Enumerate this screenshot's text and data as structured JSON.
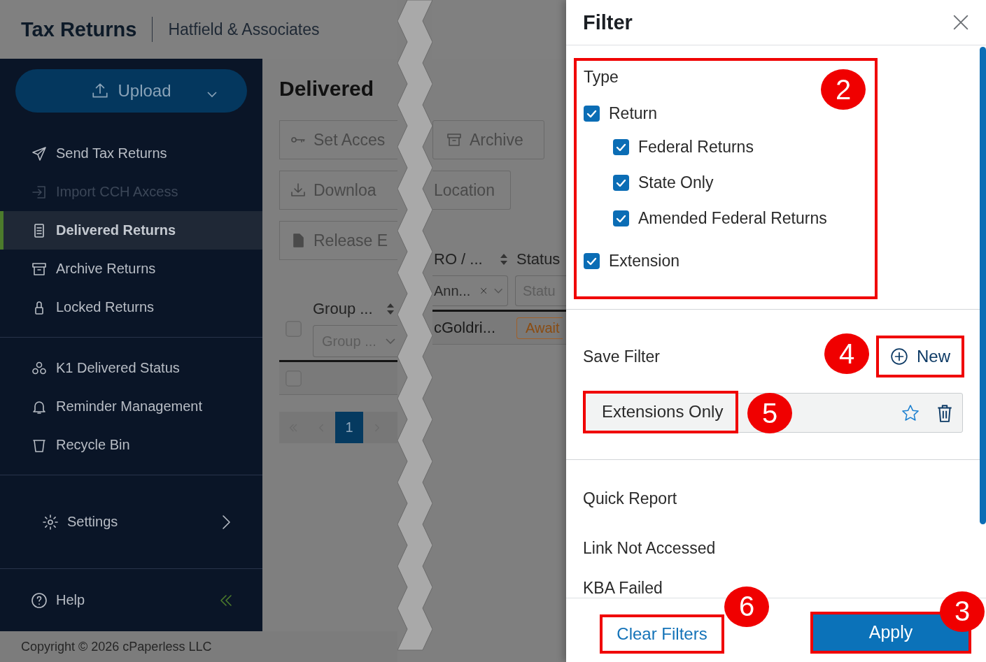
{
  "header": {
    "title": "Tax Returns",
    "firm": "Hatfield & Associates"
  },
  "sidebar": {
    "upload": "Upload",
    "groups": [
      {
        "items": [
          {
            "label": "Send Tax Returns",
            "selected": false,
            "disabled": false
          },
          {
            "label": "Import CCH Axcess",
            "selected": false,
            "disabled": true
          },
          {
            "label": "Delivered Returns",
            "selected": true,
            "disabled": false
          },
          {
            "label": "Archive Returns",
            "selected": false,
            "disabled": false
          },
          {
            "label": "Locked Returns",
            "selected": false,
            "disabled": false
          }
        ]
      },
      {
        "items": [
          {
            "label": "K1 Delivered Status",
            "selected": false,
            "disabled": false
          },
          {
            "label": "Reminder Management",
            "selected": false,
            "disabled": false
          },
          {
            "label": "Recycle Bin",
            "selected": false,
            "disabled": false
          }
        ]
      }
    ],
    "settings": "Settings",
    "help": "Help"
  },
  "content": {
    "title": "Delivered",
    "actions_left": [
      "Set Acces",
      "Downloa",
      "Release E"
    ],
    "actions_right": [
      "Archive",
      "Location"
    ],
    "table": {
      "header_checked": false,
      "columns_left": [
        {
          "label": "Group ...",
          "filter": "Group ..."
        }
      ],
      "columns_right": [
        {
          "label": "RO / ...",
          "filter_value": "Ann..."
        },
        {
          "label": "Status",
          "filter": "Statu"
        }
      ],
      "rows": [
        {
          "checked": false,
          "cell": "cGoldri...",
          "status": "Await"
        }
      ]
    },
    "pages": [
      {
        "label": "1",
        "selected": true
      }
    ]
  },
  "footer": {
    "copyright": "Copyright © 2026 cPaperless LLC"
  },
  "filter": {
    "title": "Filter",
    "type_section": {
      "title": "Type",
      "annotation": "2",
      "options": [
        {
          "label": "Return",
          "checked": true,
          "children": [
            {
              "label": "Federal Returns",
              "checked": true
            },
            {
              "label": "State Only",
              "checked": true
            },
            {
              "label": "Amended Federal Returns",
              "checked": true
            }
          ]
        },
        {
          "label": "Extension",
          "checked": true
        }
      ]
    },
    "save_filter": {
      "title": "Save Filter",
      "new_button": {
        "label": "New",
        "annotation": "4"
      },
      "saved": [
        {
          "label": "Extensions Only",
          "annotation": "5",
          "favorite": false
        }
      ]
    },
    "quick_report": {
      "title": "Quick Report",
      "items": [
        "Link Not Accessed",
        "KBA Failed"
      ]
    },
    "clear_button": {
      "label": "Clear Filters",
      "annotation": "6"
    },
    "apply_button": {
      "label": "Apply",
      "annotation": "3"
    }
  }
}
